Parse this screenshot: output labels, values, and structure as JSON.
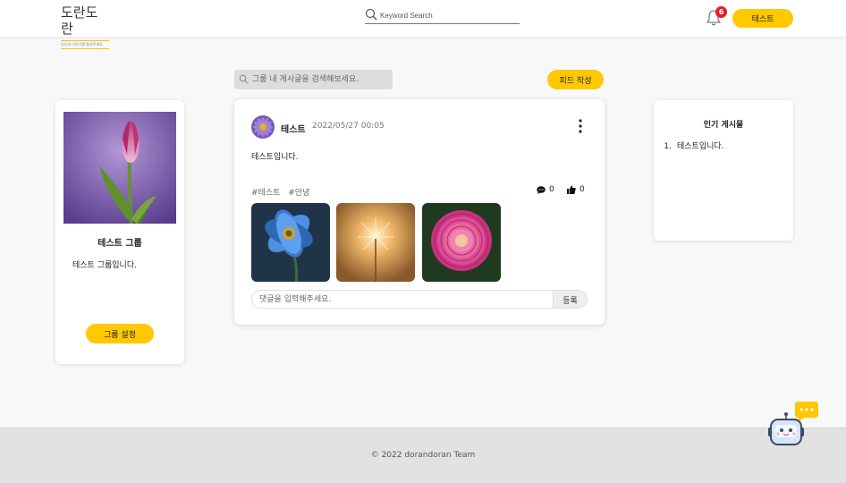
{
  "header": {
    "logo_title": "도란도란",
    "logo_subtitle": "당신의 이야기를 들려주세요",
    "search_placeholder": "Keyword Search",
    "notification_count": "6",
    "user_button": "테스트"
  },
  "group": {
    "name": "테스트 그룹",
    "description": "테스트 그룹입니다.",
    "settings_button": "그룹 설정"
  },
  "feed": {
    "search_placeholder": "그룹 내 게시글을 검색해보세요.",
    "write_button": "피드 작성",
    "post": {
      "author": "테스트",
      "date": "2022/05/27 00:05",
      "content": "테스트입니다.",
      "tags": [
        "#테스트",
        "#안녕"
      ],
      "comment_count": "0",
      "like_count": "0",
      "comment_placeholder": "댓글을 입력해주세요.",
      "submit_button": "등록"
    }
  },
  "popular": {
    "title": "인기 게시물",
    "items": [
      {
        "num": "1.",
        "title": "테스트입니다."
      }
    ]
  },
  "footer": {
    "text": "© 2022 dorandoran Team"
  },
  "colors": {
    "accent": "#ffc800",
    "badge": "#e02020",
    "background": "#f8f8f8"
  }
}
